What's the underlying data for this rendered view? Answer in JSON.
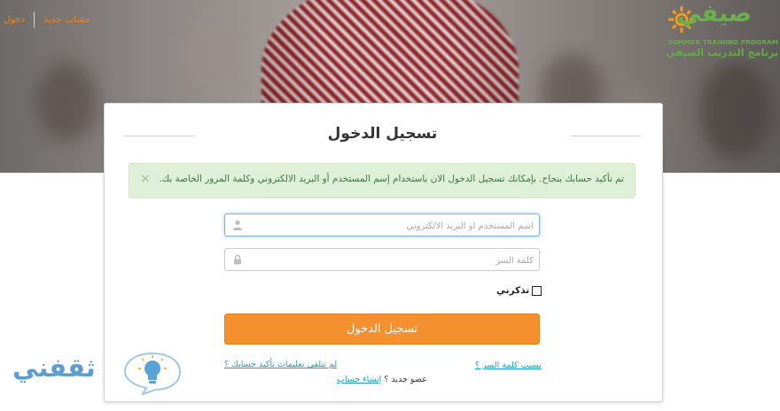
{
  "header": {
    "login_link": "دخول",
    "register_link": "حساب جديد",
    "brand_word": "صيفي",
    "brand_en": "SUMMER TRAINING PROGRAM",
    "brand_ar": "برنامج التدريب الصيفي",
    "brand_color": "#6ab04c",
    "accent_color": "#f0821e"
  },
  "card": {
    "title": "تسجيل الدخول",
    "alert": {
      "message": "تم تأكيد حسابك بنجاح. بإمكانك تسجيل الدخول الان باستخدام إسم المستخدم أو البريد الالكتروني وكلمة المرور الخاصة بك.",
      "close": "×",
      "bg_color": "#dff0d8"
    },
    "username": {
      "placeholder": "اسم المستخدم أو البريد الالكتروني",
      "value": "",
      "icon": "user-icon"
    },
    "password": {
      "placeholder": "كلمة السر",
      "value": "",
      "icon": "lock-icon"
    },
    "remember": {
      "label": "تذكرني",
      "checked": false
    },
    "submit_label": "تسجيل الدخول",
    "submit_color": "#f5902f",
    "forgot_link": "نسيت كلمة السر ؟",
    "no_confirm_link": "لم تتلقى تعليمات تأكيد حسابك ؟",
    "member_text": "عضو جديد ؟",
    "create_link": "إنشاء حساب"
  },
  "watermark": {
    "text": "ثقفني"
  }
}
